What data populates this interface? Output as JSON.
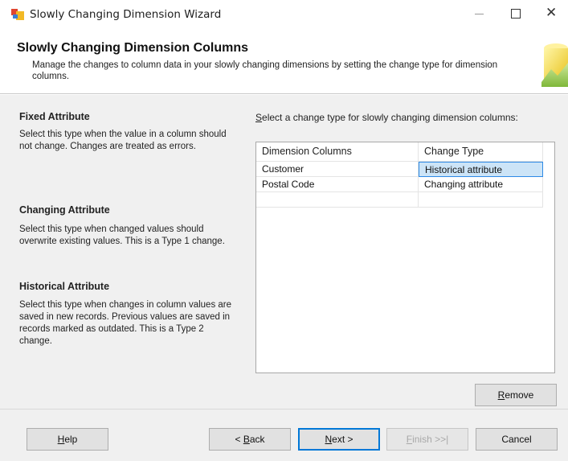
{
  "window": {
    "title": "Slowly Changing Dimension Wizard",
    "minimize_icon": "minimize-icon",
    "maximize_icon": "maximize-icon",
    "close_glyph": "✕"
  },
  "header": {
    "title": "Slowly Changing Dimension Columns",
    "description": "Manage the changes to column data in your slowly changing dimensions by setting the change type for dimension columns."
  },
  "help": {
    "sections": [
      {
        "title": "Fixed Attribute",
        "text": "Select this type when the value in a column should not change. Changes are treated as errors."
      },
      {
        "title": "Changing Attribute",
        "text": "Select this type when changed values should overwrite existing values. This is a Type 1 change."
      },
      {
        "title": "Historical Attribute",
        "text": "Select this type when changes in column values are saved in new records. Previous values are saved in records marked as outdated. This is a Type 2 change."
      }
    ]
  },
  "grid": {
    "label_prefix": "S",
    "label_rest": "elect a change type for slowly changing dimension columns:",
    "columns": [
      "Dimension Columns",
      "Change Type"
    ],
    "rows": [
      {
        "column": "Customer",
        "change_type": "Historical attribute",
        "selected": true
      },
      {
        "column": "Postal Code",
        "change_type": "Changing attribute",
        "selected": false
      }
    ]
  },
  "buttons": {
    "remove": {
      "mnemonic": "R",
      "rest": "emove"
    },
    "help": {
      "mnemonic": "H",
      "rest": "elp"
    },
    "back": {
      "pre": "< ",
      "mnemonic": "B",
      "rest": "ack"
    },
    "next": {
      "mnemonic": "N",
      "rest": "ext >"
    },
    "finish": {
      "mnemonic": "F",
      "rest": "inish >>|"
    },
    "cancel": {
      "label": "Cancel"
    }
  },
  "colors": {
    "selection_fill": "#cce4f7",
    "selection_border": "#2e8ae6",
    "focus_border": "#0078d7"
  }
}
